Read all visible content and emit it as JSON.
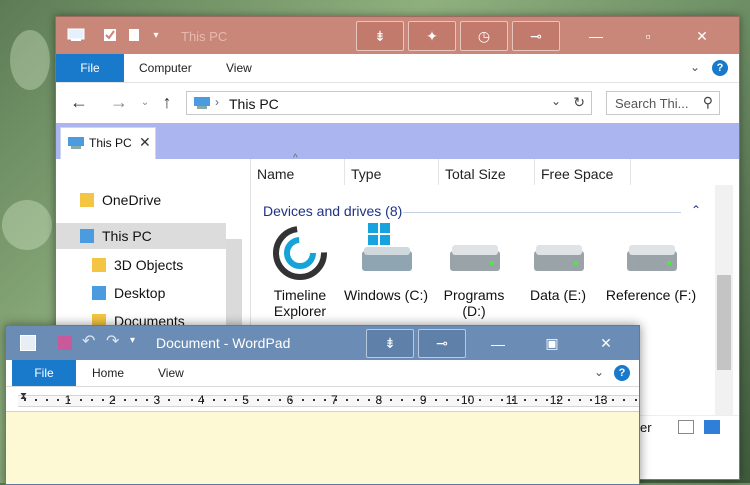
{
  "explorer": {
    "title": "This PC",
    "ribbon_tabs": [
      "File",
      "Computer",
      "View"
    ],
    "address": "This PC",
    "search_placeholder": "Search Thi...",
    "tab_label": "This PC",
    "nav_items": [
      "OneDrive",
      "This PC",
      "3D Objects",
      "Desktop",
      "Documents"
    ],
    "columns": [
      "Name",
      "Type",
      "Total Size",
      "Free Space"
    ],
    "group_label": "Devices and drives (8)",
    "tiles": [
      {
        "label": "Timeline\nExplorer",
        "icon": "timeline-explorer-icon"
      },
      {
        "label": "Windows (C:)",
        "icon": "windows-drive-icon"
      },
      {
        "label": "Programs\n(D:)",
        "icon": "drive-icon"
      },
      {
        "label": "Data (E:)",
        "icon": "drive-icon"
      },
      {
        "label": "Reference (F:)",
        "icon": "drive-icon"
      }
    ],
    "status_fragment": "er",
    "accent": "#1979ca",
    "titlebar_color": "#c9877a",
    "tabbar_color": "#abb6f1"
  },
  "wordpad": {
    "title": "Document - WordPad",
    "ribbon_tabs": [
      "File",
      "Home",
      "View"
    ],
    "ruler_numbers": [
      "1",
      "2",
      "3",
      "4",
      "5",
      "6",
      "7",
      "8",
      "9",
      "10",
      "11",
      "12",
      "13"
    ],
    "titlebar_color": "#6b8cb4",
    "page_color": "#fdf9d5"
  }
}
